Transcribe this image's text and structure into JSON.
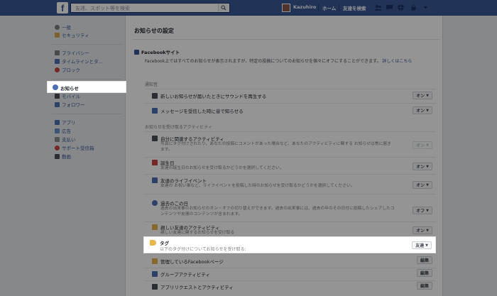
{
  "topbar": {
    "logo": "f",
    "search_placeholder": "友達、スポット等を検索",
    "user_name": "Kazuhiro",
    "home": "ホーム",
    "find_friends": "友達を検索"
  },
  "sidebar": {
    "group1": [
      {
        "label": "一般",
        "icon": "gear-icon"
      },
      {
        "label": "セキュリティ",
        "icon": "shield-icon"
      }
    ],
    "group2": [
      {
        "label": "プライバシー",
        "icon": "lock-icon"
      },
      {
        "label": "タイムラインとタ...",
        "icon": "timeline-icon"
      },
      {
        "label": "ブロック",
        "icon": "block-icon"
      }
    ],
    "active": {
      "label": "お知らせ",
      "icon": "globe-icon"
    },
    "group3": [
      {
        "label": "モバイル",
        "icon": "mobile-icon"
      },
      {
        "label": "フォロワー",
        "icon": "rss-icon"
      }
    ],
    "group4": [
      {
        "label": "アプリ",
        "icon": "apps-icon"
      },
      {
        "label": "広告",
        "icon": "ads-icon"
      },
      {
        "label": "支払い",
        "icon": "payments-icon"
      },
      {
        "label": "サポート受信箱",
        "icon": "support-icon"
      },
      {
        "label": "動画",
        "icon": "video-icon"
      }
    ]
  },
  "main": {
    "title": "お知らせの設定",
    "section": "Facebookサイト",
    "description": "Facebook上ではすべてのお知らせが表示されますが、特定の投稿についてのお知らせを個々にオフにすることができます。",
    "description_link": "詳しくはこちら",
    "notify_heading": "通知音",
    "notify_rows": [
      {
        "title": "新しいお知らせが届いたときにサウンドを再生する",
        "button": "オン",
        "icon": "speaker-icon"
      },
      {
        "title": "メッセージを受信した時に音で知らせる",
        "button": "オン",
        "icon": "chat-icon"
      }
    ],
    "receive_heading": "お知らせを受け取るアクティビティ",
    "rows": [
      {
        "title": "自分に関連するアクティビティ",
        "desc": "写真にタグ付けされたり、あなたの投稿にコメントがあった場合など、あなたのアクティビティに関する お知らせは常に届きます。",
        "button": "オン",
        "state": "disabled",
        "icon": "person-icon"
      },
      {
        "title": "誕生日",
        "desc": "友達の誕生日のお知らせを受け取るかどうかを選択してください。",
        "button": "オン",
        "state": "normal",
        "icon": "cake-icon"
      },
      {
        "title": "友達のライフイベント",
        "desc": "友達の お祝い事など、ライフイベントを投稿した時のお知らせを受け取るかどうかを選択してください。",
        "button": "オン",
        "state": "normal",
        "icon": "flag-icon"
      },
      {
        "title": "過去のこの日",
        "desc": "過去の出来事のお知らせのオン・オフの切り替えができます。過去の出来事には、過去の年のその日付に投稿したシェアしたコンテンツや友達のコンテンツが含まれます。",
        "button": "オフ",
        "state": "normal",
        "icon": "clock-icon"
      },
      {
        "title": "親しい友達のアクティビティ",
        "desc": "親しい友達に関するお知らせを受け取る",
        "button": "オン",
        "state": "normal",
        "icon": "star-icon"
      }
    ],
    "tag_row": {
      "title": "タグ",
      "desc": "以下のタグ付けについてお知らせを受け取る:",
      "button": "友達",
      "icon": "tag-icon"
    },
    "bottom_rows": [
      {
        "title": "管理しているFacebookページ",
        "button": "編集",
        "icon": "flag-icon"
      },
      {
        "title": "グループアクティビティ",
        "button": "編集",
        "icon": "group-icon"
      },
      {
        "title": "アプリリクエストとアクティビティ",
        "button": "編集",
        "icon": "puzzle-icon"
      }
    ]
  },
  "colors": {
    "topbar": "#3b5998",
    "link": "#3b5998",
    "tag_icon": "#e8b64a"
  }
}
